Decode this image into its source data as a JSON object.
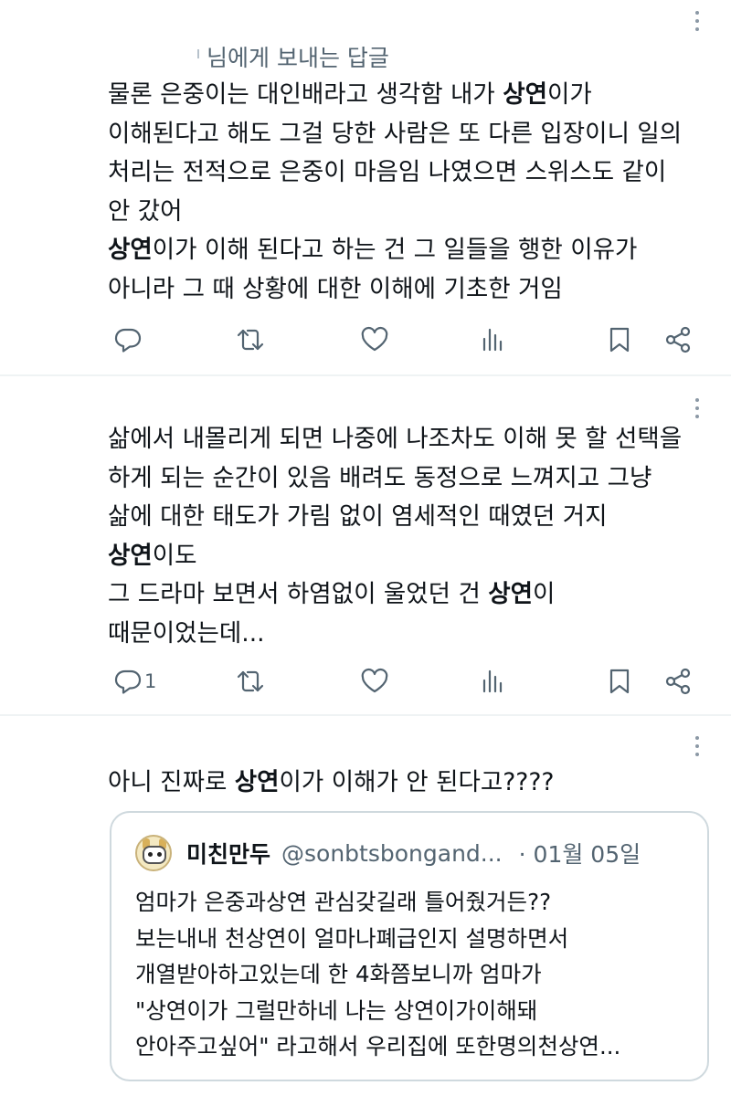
{
  "tweets": [
    {
      "reply_to": "님에게 보내는 답글",
      "lines": [
        {
          "pre": "물론 은중이는 대인배라고 생각함 내가 ",
          "bold": "상연",
          "post": "이가"
        },
        {
          "pre": "이해된다고 해도 그걸 당한 사람은 또 다른 입장이니 일의",
          "bold": "",
          "post": ""
        },
        {
          "pre": "처리는 전적으로 은중이 마음임 나였으면 스위스도 같이",
          "bold": "",
          "post": ""
        },
        {
          "pre": "안 갔어",
          "bold": "",
          "post": ""
        },
        {
          "pre": "",
          "bold": "상연",
          "post": "이가 이해 된다고 하는 건 그 일들을 행한 이유가"
        },
        {
          "pre": "아니라 그 때 상황에 대한 이해에 기초한 거임",
          "bold": "",
          "post": ""
        }
      ],
      "reply_count": ""
    },
    {
      "lines": [
        {
          "pre": "삶에서 내몰리게 되면 나중에 나조차도 이해 못 할 선택을",
          "bold": "",
          "post": ""
        },
        {
          "pre": "하게 되는 순간이 있음 배려도 동정으로 느껴지고 그냥",
          "bold": "",
          "post": ""
        },
        {
          "pre": "삶에 대한 태도가 가림 없이 염세적인 때였던 거지",
          "bold": "",
          "post": ""
        },
        {
          "pre": "",
          "bold": "상연",
          "post": "이도"
        },
        {
          "pre": "그 드라마 보면서 하염없이 울었던 건 ",
          "bold": "상연",
          "post": "이"
        },
        {
          "pre": "때문이었는데...",
          "bold": "",
          "post": ""
        }
      ],
      "reply_count": "1"
    },
    {
      "lines": [
        {
          "pre": "아니 진짜로 ",
          "bold": "상연",
          "post": "이가 이해가 안 된다고????"
        }
      ],
      "quote": {
        "name": "미친만두",
        "handle": "@sonbtsbongand...",
        "date": "· 01월 05일",
        "lines": [
          "엄마가 은중과상연 관심갖길래 틀어줬거든??",
          "보는내내 천상연이 얼마나폐급인지 설명하면서",
          "개열받아하고있는데 한 4화쯤보니까 엄마가",
          "\"상연이가 그럴만하네 나는 상연이가이해돼",
          "안아주고싶어\" 라고해서 우리집에 또한명의천상연..."
        ]
      }
    }
  ],
  "icons": {
    "reply": "reply-icon",
    "retweet": "retweet-icon",
    "like": "heart-icon",
    "views": "views-icon",
    "bookmark": "bookmark-icon",
    "share": "share-icon",
    "more": "more-icon",
    "avatar": "avatar-icon"
  },
  "colors": {
    "text": "#0f1419",
    "secondary": "#536471",
    "divider": "#eff3f4",
    "border": "#cfd9de"
  }
}
